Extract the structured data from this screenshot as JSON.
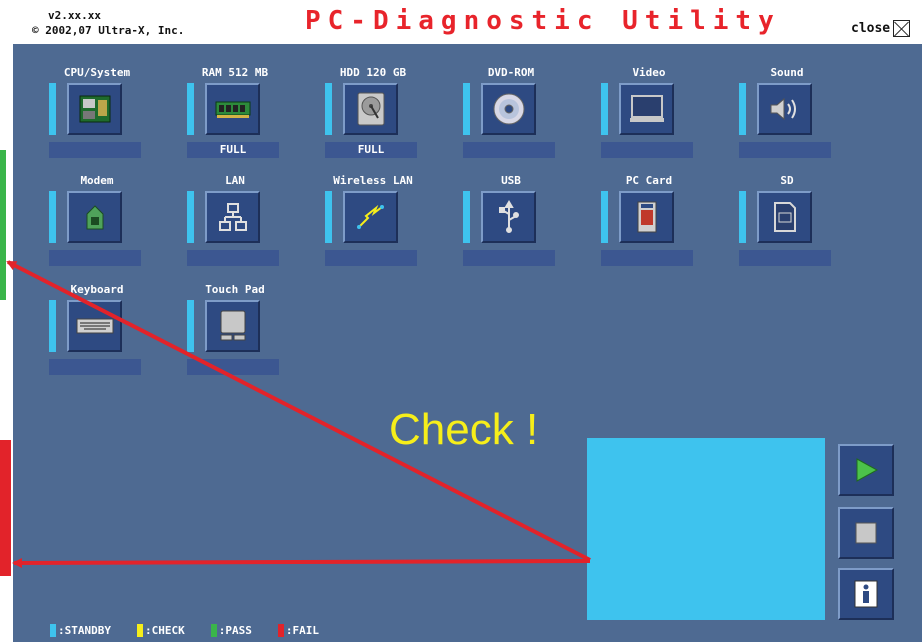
{
  "header": {
    "version": "v2.xx.xx",
    "copyright": "© 2002,07 Ultra-X, Inc.",
    "title": "PC-Diagnostic Utility",
    "close_label": "close"
  },
  "devices": [
    {
      "label": "CPU/System",
      "status": "",
      "icon": "cpu-icon",
      "indicator_color": "#3ec3ee"
    },
    {
      "label": "RAM 512 MB",
      "status": "FULL",
      "icon": "ram-icon",
      "indicator_color": "#3ec3ee"
    },
    {
      "label": "HDD 120 GB",
      "status": "FULL",
      "icon": "hdd-icon",
      "indicator_color": "#3ec3ee"
    },
    {
      "label": "DVD-ROM",
      "status": "",
      "icon": "dvd-icon",
      "indicator_color": "#3ec3ee"
    },
    {
      "label": "Video",
      "status": "",
      "icon": "video-icon",
      "indicator_color": "#3ec3ee"
    },
    {
      "label": "Sound",
      "status": "",
      "icon": "sound-icon",
      "indicator_color": "#3ec3ee"
    },
    {
      "label": "Modem",
      "status": "",
      "icon": "modem-icon",
      "indicator_color": "#3ec3ee"
    },
    {
      "label": "LAN",
      "status": "",
      "icon": "lan-icon",
      "indicator_color": "#3ec3ee"
    },
    {
      "label": "Wireless LAN",
      "status": "",
      "icon": "wireless-lan-icon",
      "indicator_color": "#3ec3ee"
    },
    {
      "label": "USB",
      "status": "",
      "icon": "usb-icon",
      "indicator_color": "#3ec3ee"
    },
    {
      "label": "PC Card",
      "status": "",
      "icon": "pc-card-icon",
      "indicator_color": "#3ec3ee"
    },
    {
      "label": "SD",
      "status": "",
      "icon": "sd-card-icon",
      "indicator_color": "#3ec3ee"
    },
    {
      "label": "Keyboard",
      "status": "",
      "icon": "keyboard-icon",
      "indicator_color": "#3ec3ee"
    },
    {
      "label": "Touch Pad",
      "status": "",
      "icon": "touchpad-icon",
      "indicator_color": "#3ec3ee"
    }
  ],
  "annotation": {
    "text": "Check !",
    "color": "#f6ee1a",
    "arrow_color": "#e2232a"
  },
  "controls": [
    {
      "name": "play-button",
      "icon": "play-icon"
    },
    {
      "name": "stop-button",
      "icon": "stop-icon"
    },
    {
      "name": "info-button",
      "icon": "info-icon"
    }
  ],
  "legend": [
    {
      "label": ":STANDBY",
      "color": "#3ec3ee"
    },
    {
      "label": ":CHECK",
      "color": "#f6ee1a"
    },
    {
      "label": ":PASS",
      "color": "#3ab54a"
    },
    {
      "label": ":FAIL",
      "color": "#e2232a"
    }
  ],
  "colors": {
    "panel_background": "#4e6a92",
    "title": "#e8242b",
    "monitor": "#3ec3ee"
  }
}
